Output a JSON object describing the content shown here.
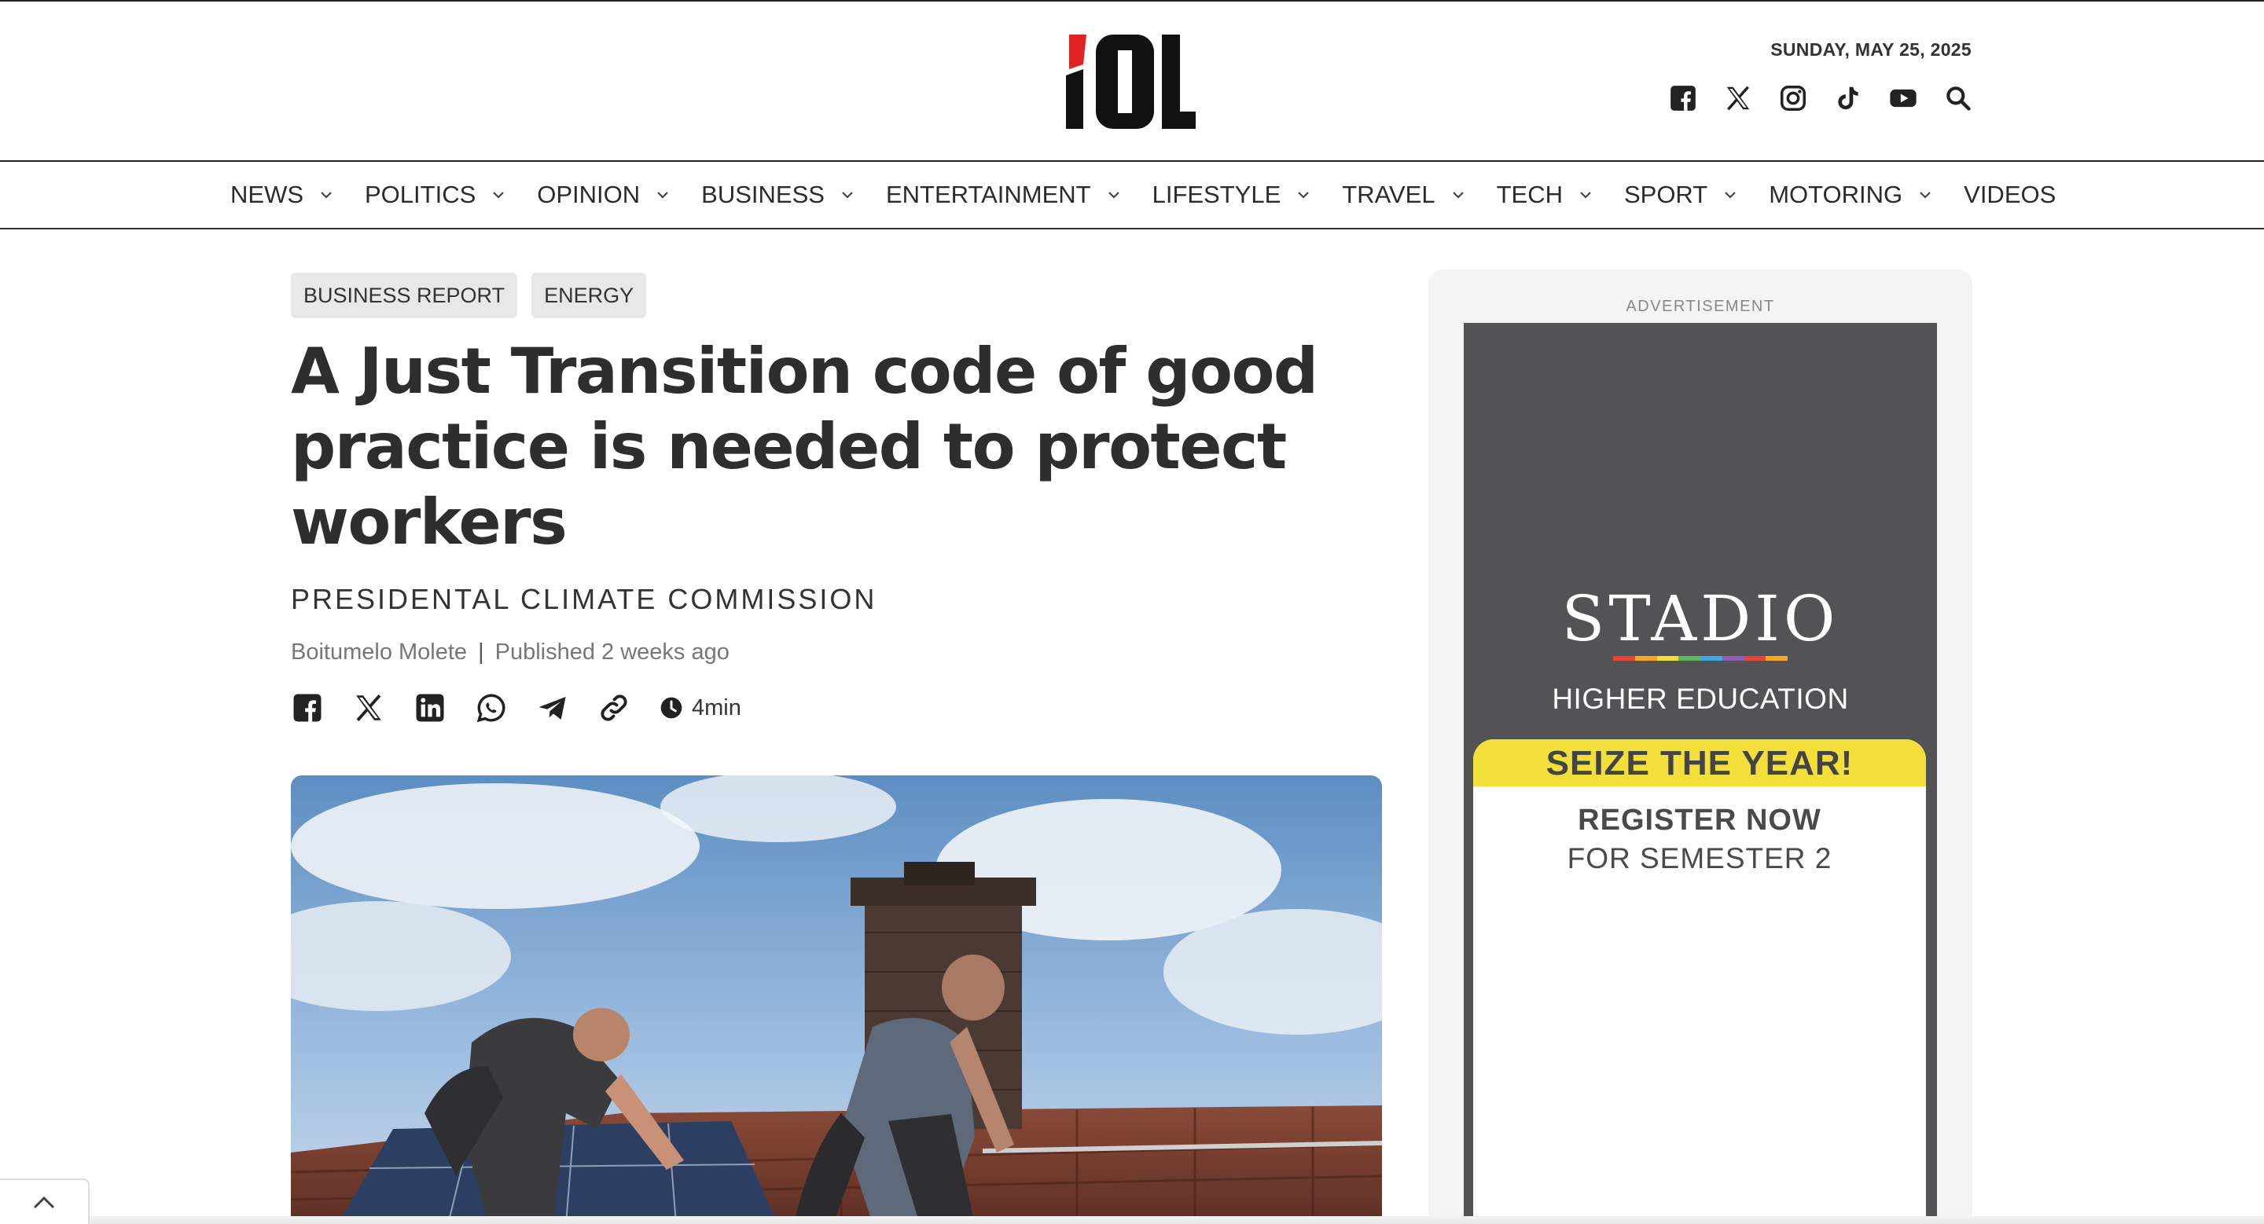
{
  "header": {
    "logo_text": "IOL",
    "date": "SUNDAY, MAY 25, 2025",
    "social_icons": [
      "facebook-icon",
      "x-icon",
      "instagram-icon",
      "tiktok-icon",
      "youtube-icon",
      "search-icon"
    ]
  },
  "nav": {
    "items": [
      {
        "label": "NEWS",
        "has_dropdown": true
      },
      {
        "label": "POLITICS",
        "has_dropdown": true
      },
      {
        "label": "OPINION",
        "has_dropdown": true
      },
      {
        "label": "BUSINESS",
        "has_dropdown": true
      },
      {
        "label": "ENTERTAINMENT",
        "has_dropdown": true
      },
      {
        "label": "LIFESTYLE",
        "has_dropdown": true
      },
      {
        "label": "TRAVEL",
        "has_dropdown": true
      },
      {
        "label": "TECH",
        "has_dropdown": true
      },
      {
        "label": "SPORT",
        "has_dropdown": true
      },
      {
        "label": "MOTORING",
        "has_dropdown": true
      },
      {
        "label": "VIDEOS",
        "has_dropdown": false
      }
    ]
  },
  "article": {
    "tags": [
      "BUSINESS REPORT",
      "ENERGY"
    ],
    "headline": "A Just Transition code of good practice is needed to protect workers",
    "subhead": "PRESIDENTAL CLIMATE COMMISSION",
    "author": "Boitumelo Molete",
    "separator": "|",
    "published": "Published 2 weeks ago",
    "share_icons": [
      "facebook-icon",
      "x-icon",
      "linkedin-icon",
      "whatsapp-icon",
      "telegram-icon",
      "copy-link-icon"
    ],
    "read_time": "4min"
  },
  "sidebar": {
    "ad_label": "ADVERTISEMENT",
    "ad": {
      "brand": "STADIO",
      "subtitle": "HIGHER EDUCATION",
      "banner": "SEIZE THE YEAR!",
      "cta_line1": "REGISTER NOW",
      "cta_line2": "FOR SEMESTER 2",
      "stripe_colors": [
        "#e9423b",
        "#f6a623",
        "#f3df3a",
        "#5cb85c",
        "#3ea8e0",
        "#8e5bb5",
        "#e9423b",
        "#f6a623"
      ]
    }
  },
  "colors": {
    "logo_red": "#e02424",
    "text_dark": "#2e2e2e",
    "tag_bg": "#e8e8e8",
    "ad_bg": "#535356",
    "ad_banner": "#f3df3a"
  }
}
